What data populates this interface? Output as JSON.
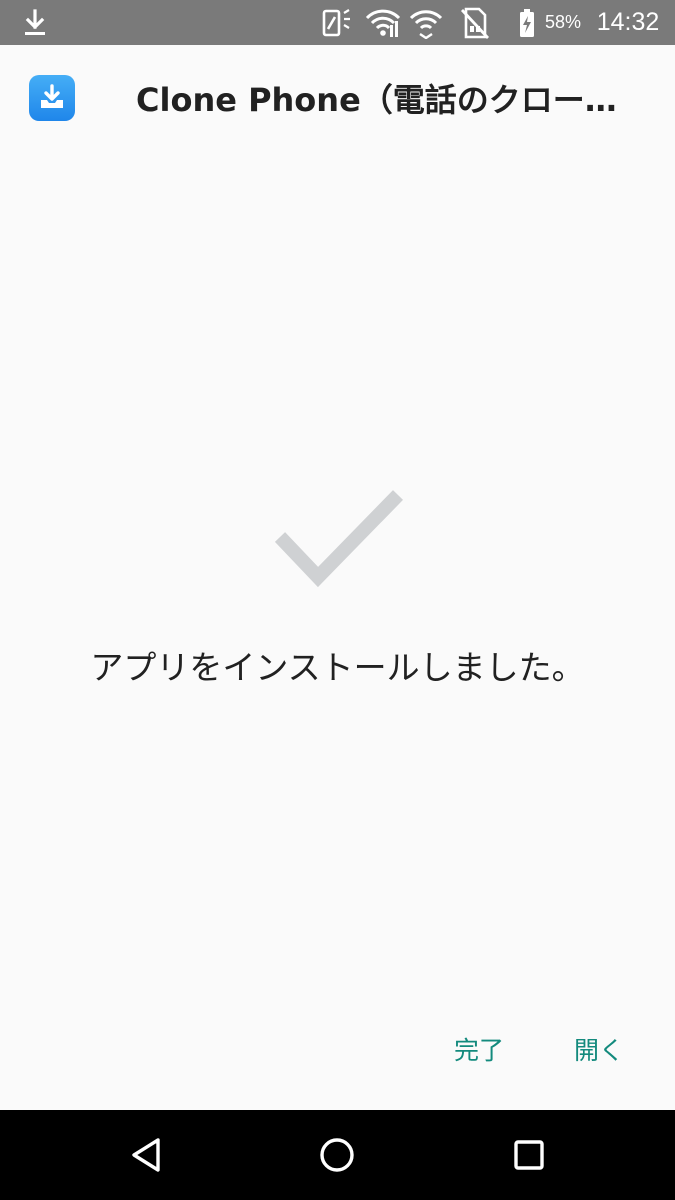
{
  "status_bar": {
    "battery_percent": "58%",
    "time": "14:32",
    "icons": [
      "download-icon",
      "signal-off-icon",
      "wifi-icon",
      "wifi-icon",
      "sim-off-icon",
      "battery-charging-icon"
    ]
  },
  "header": {
    "app_title": "Clone Phone（電話のクロー…",
    "icon": "download-tray-icon"
  },
  "main": {
    "icon": "checkmark-icon",
    "message": "アプリをインストールしました。"
  },
  "actions": {
    "done_label": "完了",
    "open_label": "開く"
  },
  "nav": {
    "icons": [
      "back-icon",
      "home-icon",
      "recents-icon"
    ]
  },
  "colors": {
    "status_bar": "#7a7a7a",
    "background": "#fafafa",
    "accent": "#138a7d",
    "checkmark": "#cfd1d3",
    "nav_bar": "#000000"
  }
}
